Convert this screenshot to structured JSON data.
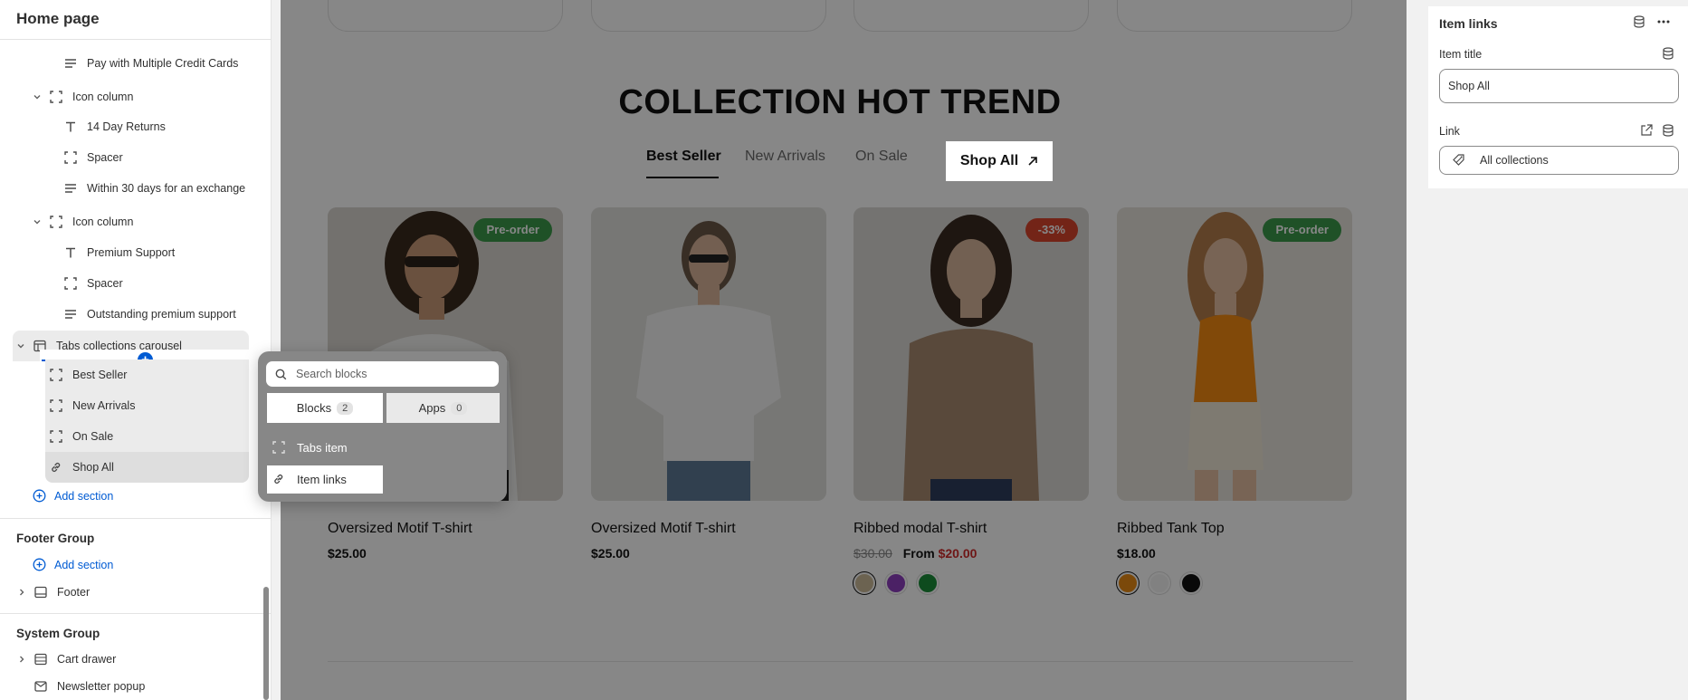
{
  "sidebar": {
    "page_title": "Home page",
    "tree": [
      {
        "label": "Pay with Multiple Credit Cards",
        "icon": "text-lines-icon"
      },
      {
        "label": "Icon column",
        "icon": "block-frame-icon"
      },
      {
        "label": "14 Day Returns",
        "icon": "text-t-icon"
      },
      {
        "label": "Spacer",
        "icon": "block-frame-icon"
      },
      {
        "label": "Within 30 days for an exchange",
        "icon": "text-lines-icon"
      },
      {
        "label": "Icon column",
        "icon": "block-frame-icon"
      },
      {
        "label": "Premium Support",
        "icon": "text-t-icon"
      },
      {
        "label": "Spacer",
        "icon": "block-frame-icon"
      },
      {
        "label": "Outstanding premium support",
        "icon": "text-lines-icon"
      },
      {
        "label": "Tabs collections carousel",
        "icon": "section-carousel-icon"
      },
      {
        "label": "Best Seller",
        "icon": "block-frame-icon"
      },
      {
        "label": "New Arrivals",
        "icon": "block-frame-icon"
      },
      {
        "label": "On Sale",
        "icon": "block-frame-icon"
      },
      {
        "label": "Shop All",
        "icon": "link-icon"
      }
    ],
    "add_section_label": "Add section",
    "footer_group": {
      "title": "Footer Group",
      "add_section_label": "Add section",
      "footer_label": "Footer"
    },
    "system_group": {
      "title": "System Group",
      "cart_drawer_label": "Cart drawer",
      "newsletter_label": "Newsletter popup"
    }
  },
  "popover": {
    "search_placeholder": "Search blocks",
    "tabs": [
      {
        "label": "Blocks",
        "count": "2"
      },
      {
        "label": "Apps",
        "count": "0"
      }
    ],
    "items": [
      {
        "label": "Tabs item",
        "icon": "block-frame-icon"
      },
      {
        "label": "Item links",
        "icon": "link-icon"
      }
    ]
  },
  "canvas": {
    "collection_title": "COLLECTION HOT TREND",
    "tabs": [
      "Best Seller",
      "New Arrivals",
      "On Sale"
    ],
    "shop_all_label": "Shop All",
    "products": [
      {
        "name": "Oversized Motif T-shirt",
        "price": "$25.00",
        "badge": "Pre-order",
        "badge_color": "#3c9a4a"
      },
      {
        "name": "Oversized Motif T-shirt",
        "price": "$25.00",
        "badge": "",
        "badge_color": ""
      },
      {
        "name": "Ribbed modal T-shirt",
        "compare_price": "$30.00",
        "price_prefix": "From",
        "price": "$20.00",
        "badge": "-33%",
        "badge_color": "#d9442d",
        "swatches": [
          "#cdbb9a",
          "#8e3fbf",
          "#1c8f3a"
        ]
      },
      {
        "name": "Ribbed Tank Top",
        "price": "$18.00",
        "badge": "Pre-order",
        "badge_color": "#3c9a4a",
        "swatches": [
          "#e88a14",
          "#f4f4f4",
          "#111111"
        ]
      }
    ]
  },
  "panel": {
    "title": "Item links",
    "item_title_label": "Item title",
    "item_title_value": "Shop All",
    "link_label": "Link",
    "link_value": "All collections"
  },
  "colors": {
    "accent": "#005bd3",
    "sale": "#d02b2b"
  }
}
